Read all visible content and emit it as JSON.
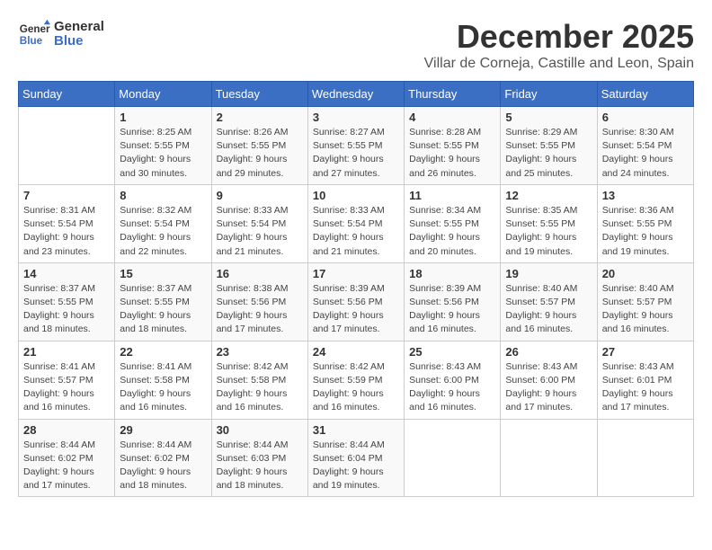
{
  "logo": {
    "line1": "General",
    "line2": "Blue"
  },
  "header": {
    "month": "December 2025",
    "location": "Villar de Corneja, Castille and Leon, Spain"
  },
  "weekdays": [
    "Sunday",
    "Monday",
    "Tuesday",
    "Wednesday",
    "Thursday",
    "Friday",
    "Saturday"
  ],
  "weeks": [
    [
      {
        "day": "",
        "info": ""
      },
      {
        "day": "1",
        "info": "Sunrise: 8:25 AM\nSunset: 5:55 PM\nDaylight: 9 hours\nand 30 minutes."
      },
      {
        "day": "2",
        "info": "Sunrise: 8:26 AM\nSunset: 5:55 PM\nDaylight: 9 hours\nand 29 minutes."
      },
      {
        "day": "3",
        "info": "Sunrise: 8:27 AM\nSunset: 5:55 PM\nDaylight: 9 hours\nand 27 minutes."
      },
      {
        "day": "4",
        "info": "Sunrise: 8:28 AM\nSunset: 5:55 PM\nDaylight: 9 hours\nand 26 minutes."
      },
      {
        "day": "5",
        "info": "Sunrise: 8:29 AM\nSunset: 5:55 PM\nDaylight: 9 hours\nand 25 minutes."
      },
      {
        "day": "6",
        "info": "Sunrise: 8:30 AM\nSunset: 5:54 PM\nDaylight: 9 hours\nand 24 minutes."
      }
    ],
    [
      {
        "day": "7",
        "info": "Sunrise: 8:31 AM\nSunset: 5:54 PM\nDaylight: 9 hours\nand 23 minutes."
      },
      {
        "day": "8",
        "info": "Sunrise: 8:32 AM\nSunset: 5:54 PM\nDaylight: 9 hours\nand 22 minutes."
      },
      {
        "day": "9",
        "info": "Sunrise: 8:33 AM\nSunset: 5:54 PM\nDaylight: 9 hours\nand 21 minutes."
      },
      {
        "day": "10",
        "info": "Sunrise: 8:33 AM\nSunset: 5:54 PM\nDaylight: 9 hours\nand 21 minutes."
      },
      {
        "day": "11",
        "info": "Sunrise: 8:34 AM\nSunset: 5:55 PM\nDaylight: 9 hours\nand 20 minutes."
      },
      {
        "day": "12",
        "info": "Sunrise: 8:35 AM\nSunset: 5:55 PM\nDaylight: 9 hours\nand 19 minutes."
      },
      {
        "day": "13",
        "info": "Sunrise: 8:36 AM\nSunset: 5:55 PM\nDaylight: 9 hours\nand 19 minutes."
      }
    ],
    [
      {
        "day": "14",
        "info": "Sunrise: 8:37 AM\nSunset: 5:55 PM\nDaylight: 9 hours\nand 18 minutes."
      },
      {
        "day": "15",
        "info": "Sunrise: 8:37 AM\nSunset: 5:55 PM\nDaylight: 9 hours\nand 18 minutes."
      },
      {
        "day": "16",
        "info": "Sunrise: 8:38 AM\nSunset: 5:56 PM\nDaylight: 9 hours\nand 17 minutes."
      },
      {
        "day": "17",
        "info": "Sunrise: 8:39 AM\nSunset: 5:56 PM\nDaylight: 9 hours\nand 17 minutes."
      },
      {
        "day": "18",
        "info": "Sunrise: 8:39 AM\nSunset: 5:56 PM\nDaylight: 9 hours\nand 16 minutes."
      },
      {
        "day": "19",
        "info": "Sunrise: 8:40 AM\nSunset: 5:57 PM\nDaylight: 9 hours\nand 16 minutes."
      },
      {
        "day": "20",
        "info": "Sunrise: 8:40 AM\nSunset: 5:57 PM\nDaylight: 9 hours\nand 16 minutes."
      }
    ],
    [
      {
        "day": "21",
        "info": "Sunrise: 8:41 AM\nSunset: 5:57 PM\nDaylight: 9 hours\nand 16 minutes."
      },
      {
        "day": "22",
        "info": "Sunrise: 8:41 AM\nSunset: 5:58 PM\nDaylight: 9 hours\nand 16 minutes."
      },
      {
        "day": "23",
        "info": "Sunrise: 8:42 AM\nSunset: 5:58 PM\nDaylight: 9 hours\nand 16 minutes."
      },
      {
        "day": "24",
        "info": "Sunrise: 8:42 AM\nSunset: 5:59 PM\nDaylight: 9 hours\nand 16 minutes."
      },
      {
        "day": "25",
        "info": "Sunrise: 8:43 AM\nSunset: 6:00 PM\nDaylight: 9 hours\nand 16 minutes."
      },
      {
        "day": "26",
        "info": "Sunrise: 8:43 AM\nSunset: 6:00 PM\nDaylight: 9 hours\nand 17 minutes."
      },
      {
        "day": "27",
        "info": "Sunrise: 8:43 AM\nSunset: 6:01 PM\nDaylight: 9 hours\nand 17 minutes."
      }
    ],
    [
      {
        "day": "28",
        "info": "Sunrise: 8:44 AM\nSunset: 6:02 PM\nDaylight: 9 hours\nand 17 minutes."
      },
      {
        "day": "29",
        "info": "Sunrise: 8:44 AM\nSunset: 6:02 PM\nDaylight: 9 hours\nand 18 minutes."
      },
      {
        "day": "30",
        "info": "Sunrise: 8:44 AM\nSunset: 6:03 PM\nDaylight: 9 hours\nand 18 minutes."
      },
      {
        "day": "31",
        "info": "Sunrise: 8:44 AM\nSunset: 6:04 PM\nDaylight: 9 hours\nand 19 minutes."
      },
      {
        "day": "",
        "info": ""
      },
      {
        "day": "",
        "info": ""
      },
      {
        "day": "",
        "info": ""
      }
    ]
  ]
}
